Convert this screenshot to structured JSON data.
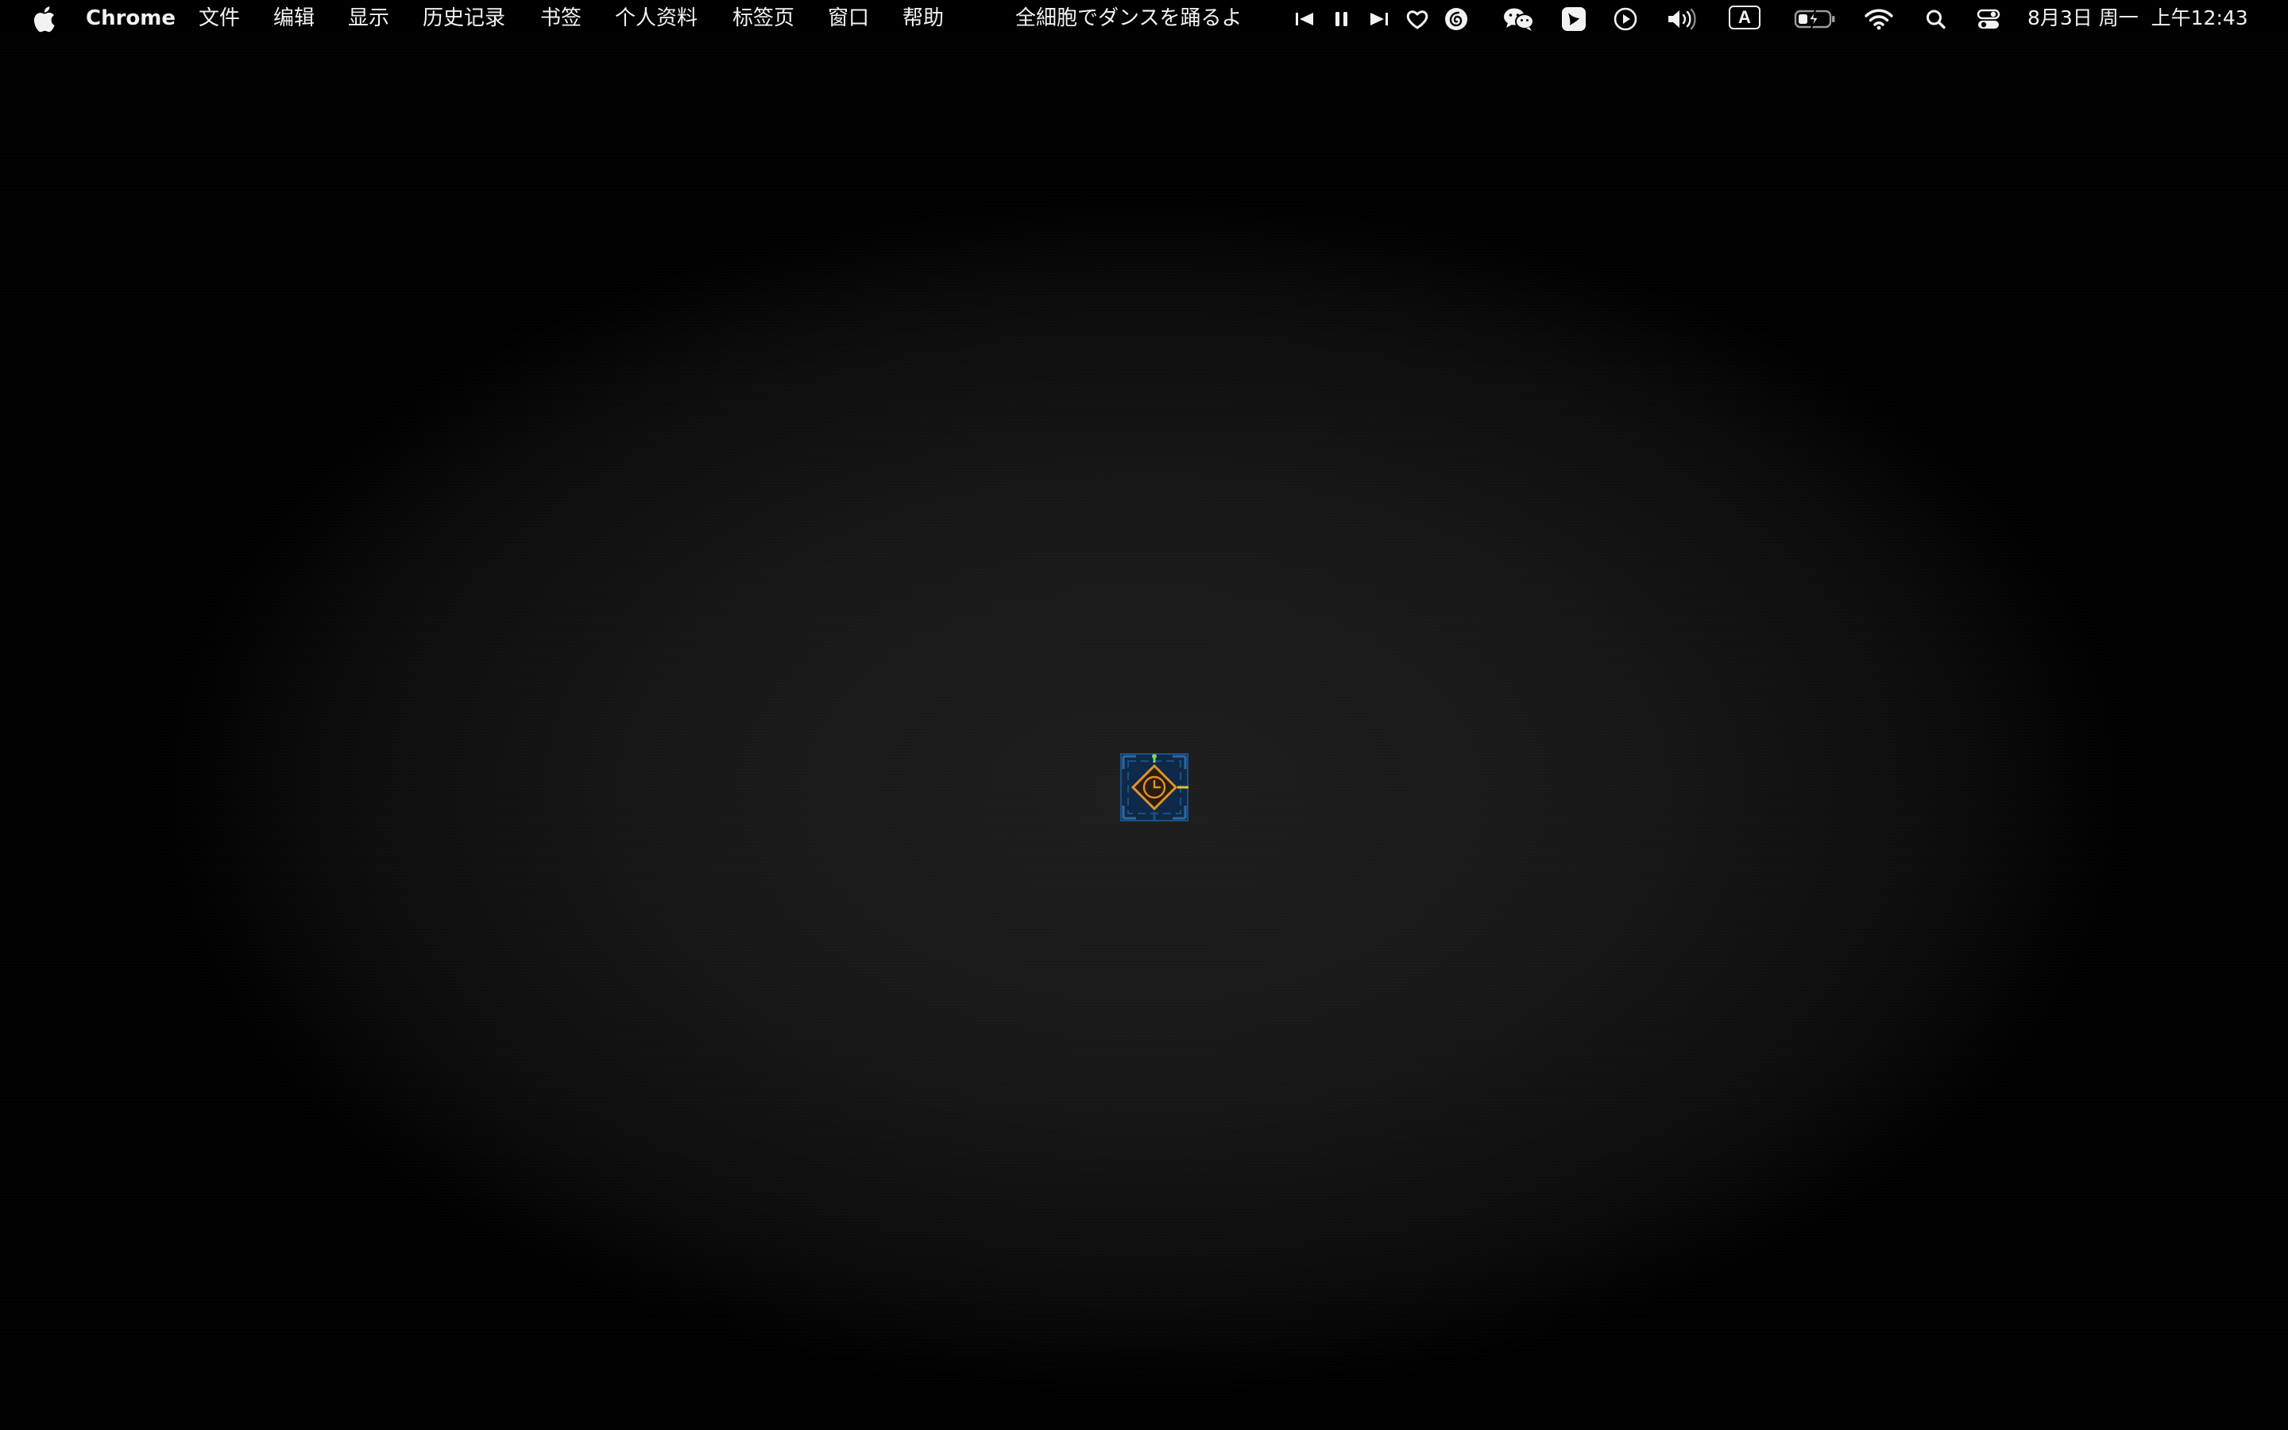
{
  "menubar": {
    "apple_icon": "apple-logo-icon",
    "app_name": "Chrome",
    "menus": [
      "文件",
      "编辑",
      "显示",
      "历史记录",
      "书签",
      "个人资料",
      "标签页",
      "窗口",
      "帮助"
    ],
    "now_playing": "全細胞でダンスを踊るよ",
    "media_controls": [
      "previous-track-icon",
      "pause-icon",
      "next-track-icon",
      "heart-icon",
      "netease-music-icon"
    ],
    "status_icons": [
      "wechat-icon",
      "bird-app-icon",
      "play-circle-icon",
      "volume-icon",
      "input-method-icon",
      "battery-charging-icon",
      "wifi-icon",
      "spotlight-search-icon",
      "control-center-icon"
    ],
    "input_method_label": "A",
    "clock": "8月3日 周一  上午12:43"
  },
  "desktop": {
    "center_icon": "target-clock-icon",
    "colors": {
      "background_center": "#1e1e1e",
      "background_edge": "#000000",
      "icon_blue": "#1c4f86",
      "icon_orange": "#e0922c",
      "icon_green": "#7ed26a"
    }
  }
}
